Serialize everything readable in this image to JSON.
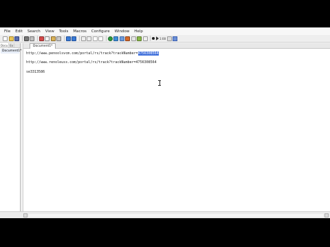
{
  "menu": {
    "items": [
      "File",
      "Edit",
      "Search",
      "View",
      "Tools",
      "Macros",
      "Configure",
      "Window",
      "Help"
    ]
  },
  "toolbar": {
    "zoom_label": "1:08"
  },
  "sidepanel": {
    "tab1": "Docu",
    "tab2": "Ex",
    "doc_item": "Document1*"
  },
  "editor": {
    "tab_label": "Document1*",
    "line1_text": "http://www.penoolsvcm.com/portal/rs/track?trackNumber=",
    "line1_sel": "4756308564",
    "line2_text": "http://www.renoleuss.com/portal/rs/track?trackNumber=4756308564",
    "line3_text": "se3313586"
  }
}
